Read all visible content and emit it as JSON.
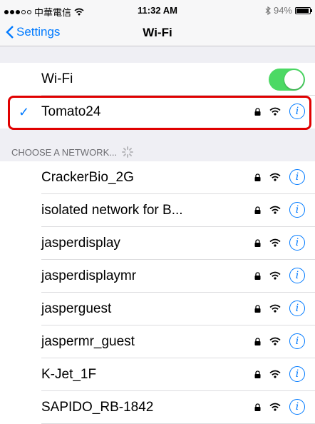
{
  "status_bar": {
    "carrier": "中華電信",
    "time": "11:32 AM",
    "battery": "94%",
    "battery_level": 0.94
  },
  "nav": {
    "back_label": "Settings",
    "title": "Wi-Fi"
  },
  "wifi_toggle": {
    "label": "Wi-Fi",
    "on": true
  },
  "connected": {
    "name": "Tomato24"
  },
  "section_header": "CHOOSE A NETWORK...",
  "networks": [
    "CrackerBio_2G",
    "isolated network for B...",
    "jasperdisplay",
    "jasperdisplaymr",
    "jasperguest",
    "jaspermr_guest",
    "K-Jet_1F",
    "SAPIDO_RB-1842"
  ],
  "colors": {
    "accent": "#007aff",
    "toggle_on": "#4cd964",
    "highlight": "#e00000"
  }
}
